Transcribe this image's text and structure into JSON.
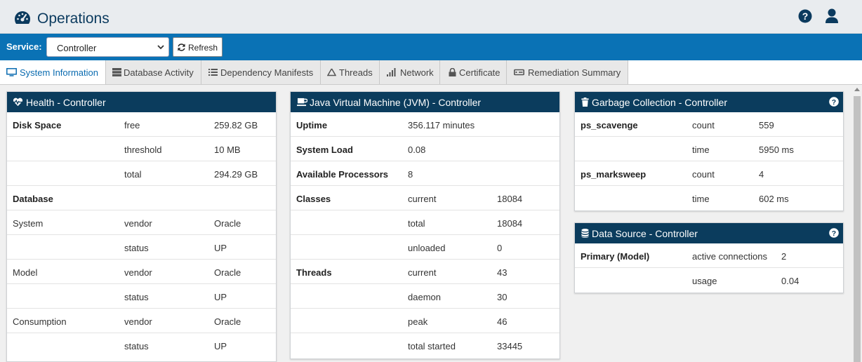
{
  "header": {
    "title": "Operations"
  },
  "service": {
    "label": "Service:",
    "selected": "Controller",
    "refresh_label": "Refresh"
  },
  "tabs": [
    {
      "label": "System Information",
      "icon": "monitor-icon",
      "active": true
    },
    {
      "label": "Database Activity",
      "icon": "server-icon"
    },
    {
      "label": "Dependency Manifests",
      "icon": "list-icon"
    },
    {
      "label": "Threads",
      "icon": "recycle-icon"
    },
    {
      "label": "Network",
      "icon": "signal-icon"
    },
    {
      "label": "Certificate",
      "icon": "lock-icon"
    },
    {
      "label": "Remediation Summary",
      "icon": "hdd-icon"
    }
  ],
  "health": {
    "title": "Health - Controller",
    "rows": [
      [
        "Disk Space",
        "free",
        "259.82 GB"
      ],
      [
        "",
        "threshold",
        "10 MB"
      ],
      [
        "",
        "total",
        "294.29 GB"
      ],
      [
        "Database",
        "",
        ""
      ],
      [
        "System",
        "vendor",
        "Oracle"
      ],
      [
        "",
        "status",
        "UP"
      ],
      [
        "Model",
        "vendor",
        "Oracle"
      ],
      [
        "",
        "status",
        "UP"
      ],
      [
        "Consumption",
        "vendor",
        "Oracle"
      ],
      [
        "",
        "status",
        "UP"
      ]
    ]
  },
  "jvm": {
    "title": "Java Virtual Machine (JVM) - Controller",
    "rows": [
      [
        "Uptime",
        "356.117 minutes",
        ""
      ],
      [
        "System Load",
        "0.08",
        ""
      ],
      [
        "Available Processors",
        "8",
        ""
      ],
      [
        "Classes",
        "current",
        "18084"
      ],
      [
        "",
        "total",
        "18084"
      ],
      [
        "",
        "unloaded",
        "0"
      ],
      [
        "Threads",
        "current",
        "43"
      ],
      [
        "",
        "daemon",
        "30"
      ],
      [
        "",
        "peak",
        "46"
      ],
      [
        "",
        "total started",
        "33445"
      ]
    ]
  },
  "gc": {
    "title": "Garbage Collection - Controller",
    "rows": [
      [
        "ps_scavenge",
        "count",
        "559"
      ],
      [
        "",
        "time",
        "5950 ms"
      ],
      [
        "ps_marksweep",
        "count",
        "4"
      ],
      [
        "",
        "time",
        "602 ms"
      ]
    ]
  },
  "datasource": {
    "title": "Data Source - Controller",
    "rows": [
      [
        "Primary (Model)",
        "active connections",
        "2"
      ],
      [
        "",
        "usage",
        "0.04"
      ]
    ]
  }
}
